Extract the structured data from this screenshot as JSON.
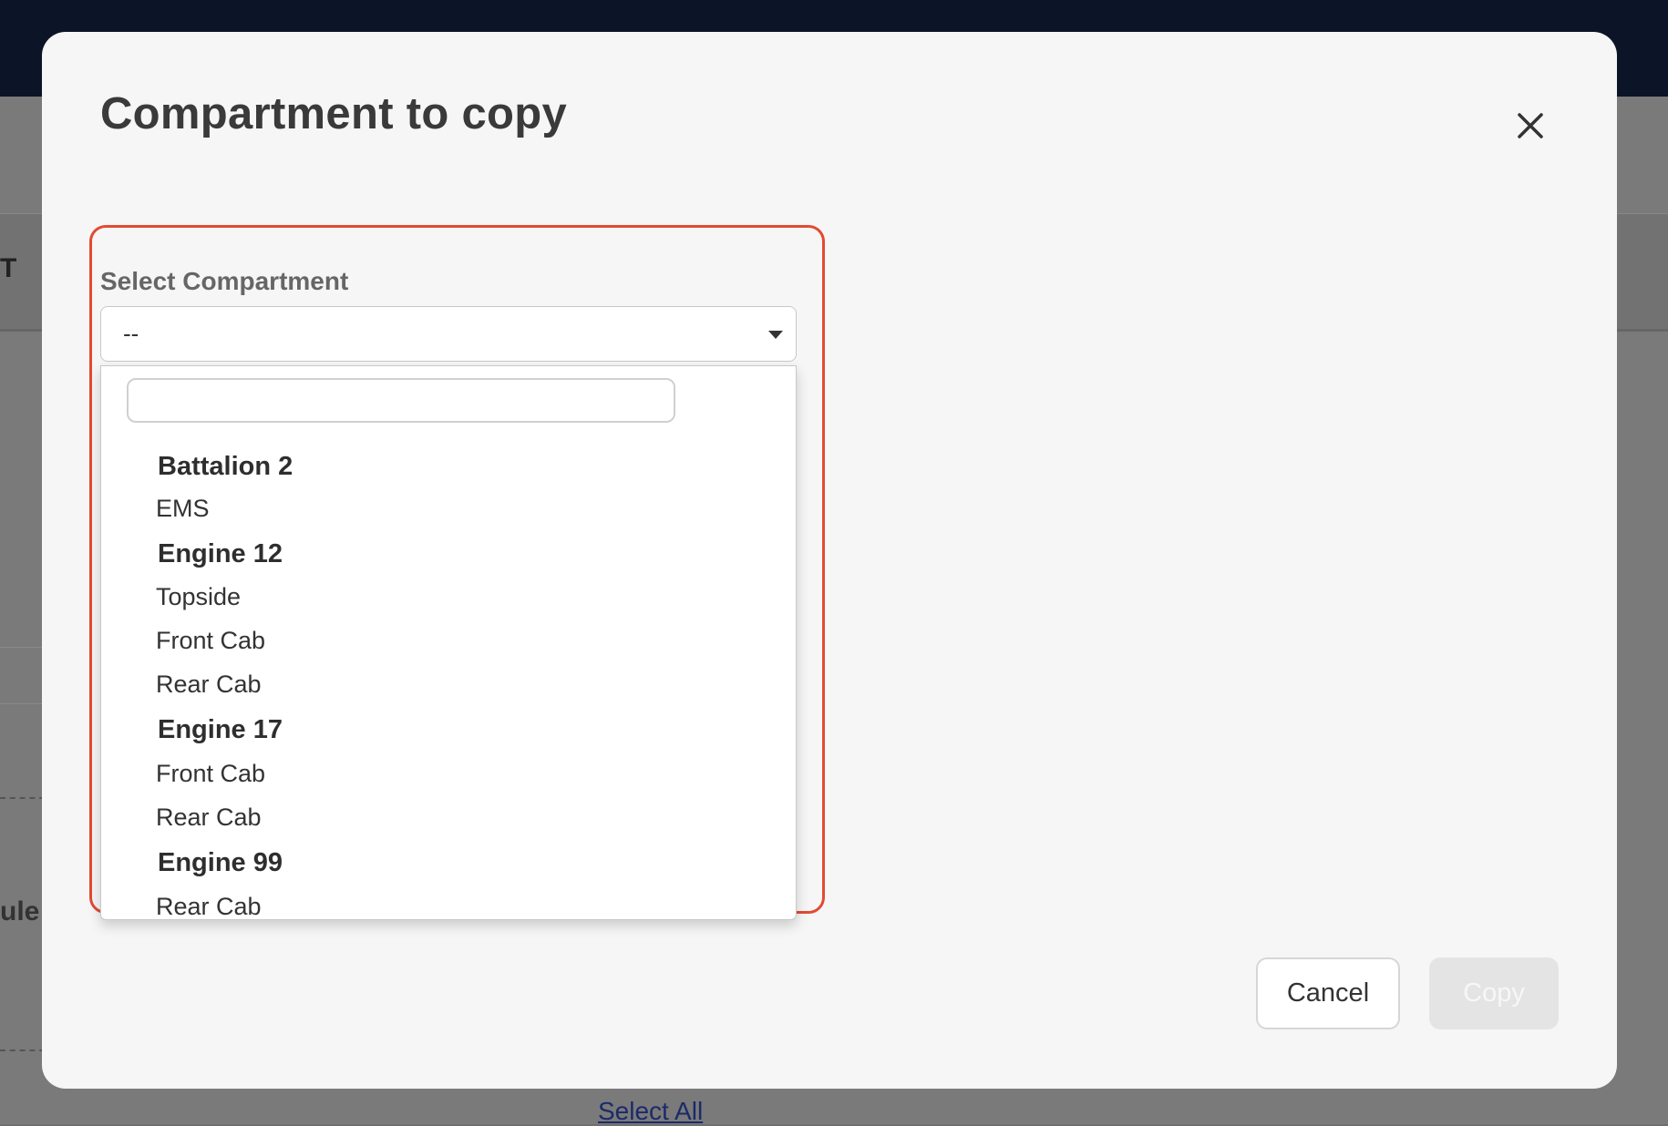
{
  "modal": {
    "title": "Compartment to copy"
  },
  "field": {
    "label": "Select Compartment",
    "selected_value": "--",
    "search_value": ""
  },
  "dropdown": {
    "options": [
      {
        "label": "Battalion 2",
        "type": "group"
      },
      {
        "label": "EMS",
        "type": "option"
      },
      {
        "label": "Engine 12",
        "type": "group"
      },
      {
        "label": "Topside",
        "type": "option"
      },
      {
        "label": "Front Cab",
        "type": "option"
      },
      {
        "label": "Rear Cab",
        "type": "option"
      },
      {
        "label": "Engine 17",
        "type": "group"
      },
      {
        "label": "Front Cab",
        "type": "option"
      },
      {
        "label": "Rear Cab",
        "type": "option"
      },
      {
        "label": "Engine 99",
        "type": "group"
      },
      {
        "label": "Rear Cab",
        "type": "option"
      }
    ]
  },
  "actions": {
    "cancel_label": "Cancel",
    "copy_label": "Copy"
  },
  "background": {
    "fragment_t": "T",
    "fragment_ule": "ule c",
    "select_all_label": "Select All"
  },
  "colors": {
    "highlight_border": "#e34a33",
    "topbar": "#0c1427"
  }
}
